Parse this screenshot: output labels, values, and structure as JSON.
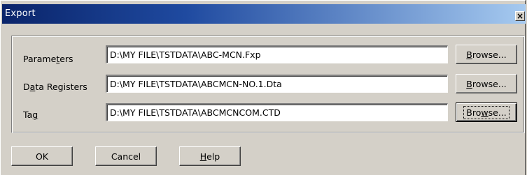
{
  "window": {
    "title": "Export",
    "close_glyph": "×"
  },
  "rows": [
    {
      "label_pre": "Parame",
      "label_key": "t",
      "label_post": "ers",
      "value": "D:\\MY FILE\\TSTDATA\\ABC-MCN.Fxp"
    },
    {
      "label_pre": "D",
      "label_key": "a",
      "label_post": "ta Registers",
      "value": "D:\\MY FILE\\TSTDATA\\ABCMCN-NO.1.Dta"
    },
    {
      "label_pre": "Ta",
      "label_key": "g",
      "label_post": "",
      "value": "D:\\MY FILE\\TSTDATA\\ABCMCNCOM.CTD"
    }
  ],
  "browse": [
    {
      "pre": "",
      "key": "B",
      "post": "rowse..."
    },
    {
      "pre": "",
      "key": "B",
      "post": "rowse..."
    },
    {
      "pre": "Bro",
      "key": "w",
      "post": "se..."
    }
  ],
  "buttons": {
    "ok": "OK",
    "cancel": "Cancel",
    "help_key": "H",
    "help_rest": "elp"
  }
}
